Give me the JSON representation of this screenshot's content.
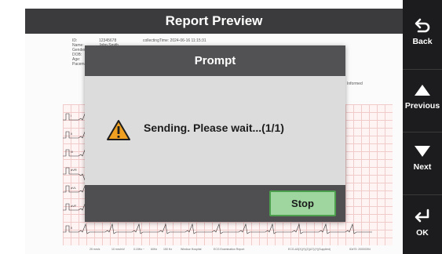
{
  "window": {
    "title": "Report Preview"
  },
  "report": {
    "fields": [
      {
        "label": "ID:",
        "value": "12345678"
      },
      {
        "label": "Name:",
        "value": "John Smith"
      },
      {
        "label": "Gender:",
        "value": ""
      },
      {
        "label": "DOB:",
        "value": ""
      },
      {
        "label": "Age:",
        "value": ""
      },
      {
        "label": "Pacema...",
        "value": ""
      }
    ],
    "collecting_time": "collectingTime: 2024-06-16 11:15:31",
    "right_note": "Informed",
    "lead_labels": [
      "I",
      "II",
      "III",
      "aVR",
      "aVL",
      "aVF",
      "II"
    ],
    "footer_items": [
      "25 mm/s",
      "10 mm/mV",
      "0.15Hz ~",
      "60Hz",
      "150 Hz",
      "Windsor Hospital",
      "ECG Examination Report",
      "ECG-A3(X)(Y)(Z)(A7)(Y)(Supplied)",
      "ID#70: 20000394"
    ]
  },
  "dialog": {
    "title": "Prompt",
    "icon": "warning-icon",
    "message": "Sending. Please wait...(1/1)",
    "stop_label": "Stop"
  },
  "side_panel": {
    "back_label": "Back",
    "previous_label": "Previous",
    "next_label": "Next",
    "ok_label": "OK"
  },
  "colors": {
    "title_bar": "#3b3b3d",
    "dialog_header": "#525254",
    "stop_button": "#9fd59f",
    "stop_border": "#4c9f4c",
    "warning": "#f0a020",
    "side_panel": "#1c1c1e"
  }
}
